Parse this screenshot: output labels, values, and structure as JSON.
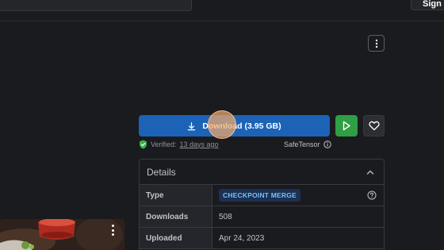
{
  "header": {
    "signin_label": "Sign In"
  },
  "actions": {
    "download_label": "Download (3.95 GB)",
    "play_icon": "play-icon",
    "favorite_icon": "heart-icon",
    "more_icon": "kebab-menu-icon"
  },
  "verification": {
    "verified_prefix": "Verified:",
    "verified_when": "13 days ago",
    "format_label": "SafeTensor"
  },
  "details": {
    "title": "Details",
    "rows": [
      {
        "label": "Type",
        "value": "CHECKPOINT MERGE"
      },
      {
        "label": "Downloads",
        "value": "508"
      },
      {
        "label": "Uploaded",
        "value": "Apr 24, 2023"
      }
    ]
  },
  "colors": {
    "primary": "#1c63b7",
    "play_green": "#2f9e44",
    "badge_bg": "#1c3050",
    "badge_text": "#74c0fc",
    "verified_green": "#37b24d"
  }
}
